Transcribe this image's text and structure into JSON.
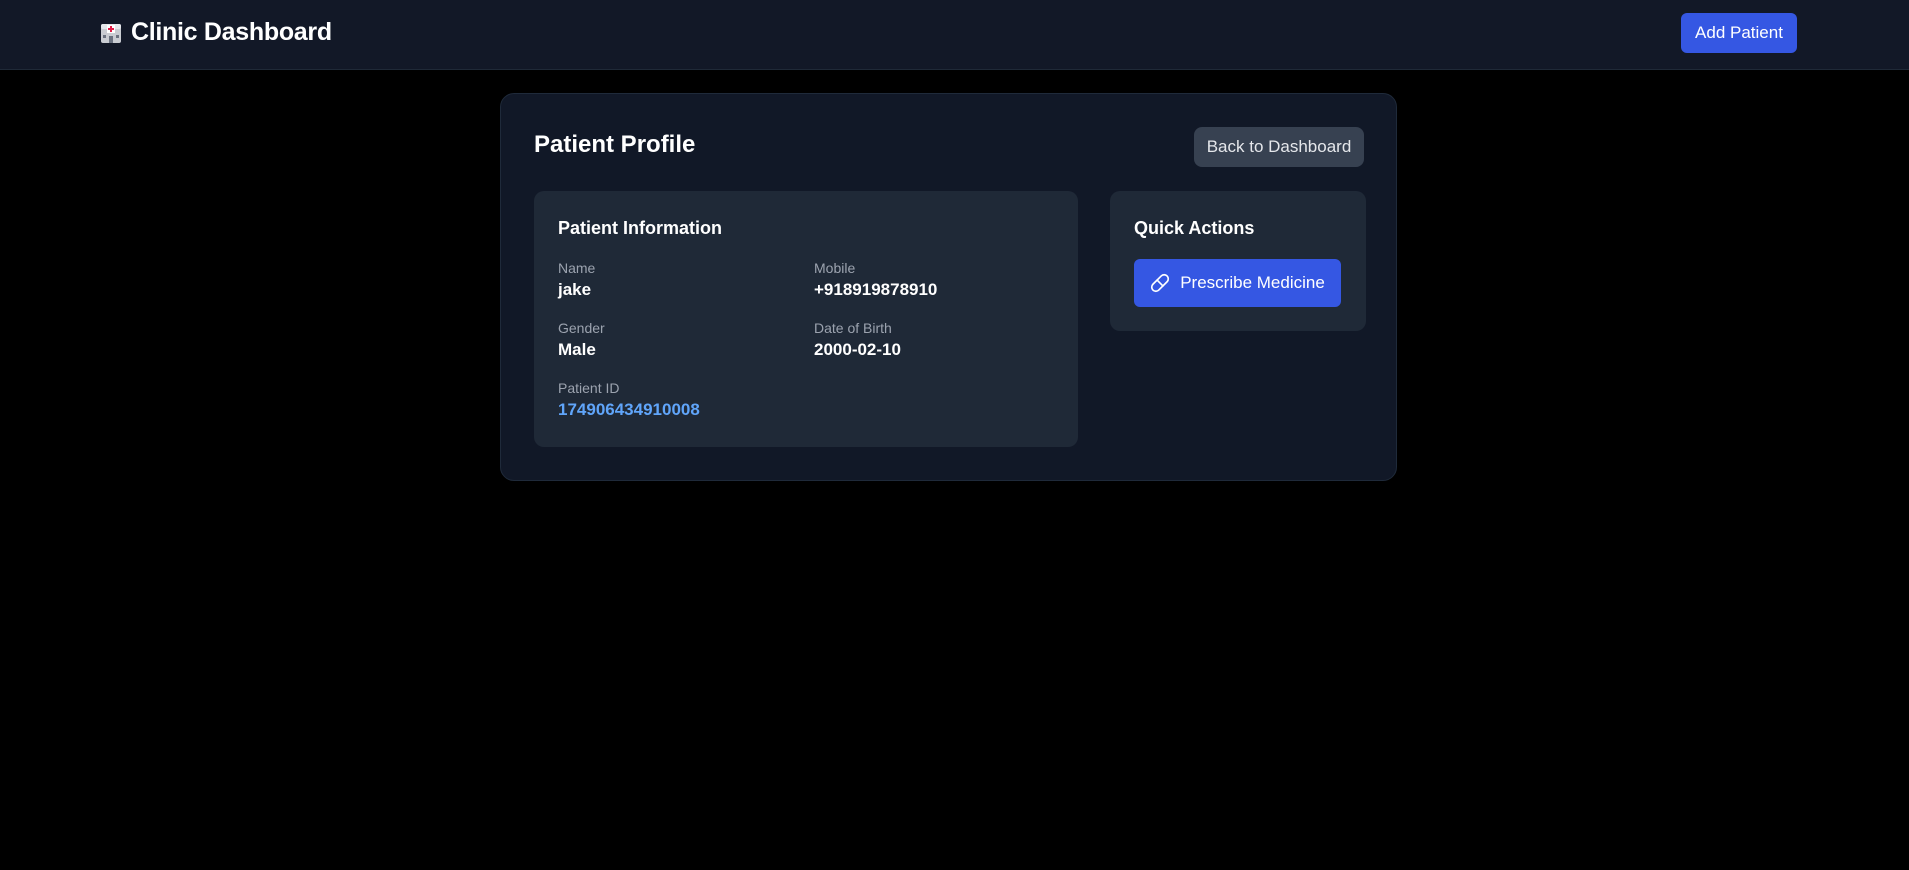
{
  "header": {
    "title": "Clinic Dashboard",
    "brand_icon": "hospital-icon",
    "add_patient_label": "Add Patient"
  },
  "profile": {
    "title": "Patient Profile",
    "back_label": "Back to Dashboard",
    "info": {
      "title": "Patient Information",
      "fields": {
        "name": {
          "label": "Name",
          "value": "jake"
        },
        "mobile": {
          "label": "Mobile",
          "value": "+918919878910"
        },
        "gender": {
          "label": "Gender",
          "value": "Male"
        },
        "dob": {
          "label": "Date of Birth",
          "value": "2000-02-10"
        },
        "pid": {
          "label": "Patient ID",
          "value": "174906434910008"
        }
      }
    },
    "actions": {
      "title": "Quick Actions",
      "prescribe_label": "Prescribe Medicine",
      "prescribe_icon": "pill-icon"
    }
  },
  "colors": {
    "accent": "#3557e3",
    "link": "#60a5fa",
    "panel": "#1f2937",
    "card": "#111827"
  }
}
